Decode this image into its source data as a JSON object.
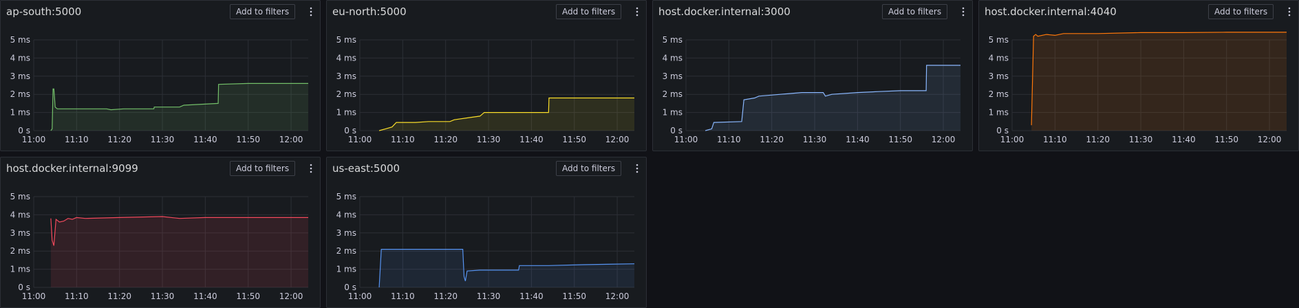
{
  "panels": [
    {
      "title": "ap-south:5000",
      "add_filters_label": "Add to filters",
      "menu_icon": "vertical-dots-icon",
      "color": "#73bf69",
      "fill": "rgba(115,191,105,0.12)",
      "chart_data": {
        "type": "line",
        "x_unit": "time",
        "y_unit": "ms",
        "y_ticks": [
          "0 s",
          "1 ms",
          "2 ms",
          "3 ms",
          "4 ms",
          "5 ms"
        ],
        "x_ticks": [
          "11:00",
          "11:10",
          "11:20",
          "11:30",
          "11:40",
          "11:50",
          "12:00"
        ],
        "ylim": [
          0,
          5
        ],
        "xlim_minutes": [
          0,
          64
        ],
        "series": [
          {
            "points": [
              [
                4.0,
                0
              ],
              [
                4.3,
                0.1
              ],
              [
                4.5,
                2.3
              ],
              [
                4.7,
                2.3
              ],
              [
                5.0,
                1.3
              ],
              [
                5.5,
                1.2
              ],
              [
                12,
                1.2
              ],
              [
                17,
                1.2
              ],
              [
                18,
                1.15
              ],
              [
                21,
                1.2
              ],
              [
                28,
                1.2
              ],
              [
                28.1,
                1.3
              ],
              [
                34,
                1.3
              ],
              [
                35,
                1.4
              ],
              [
                43,
                1.5
              ],
              [
                43.1,
                2.55
              ],
              [
                50,
                2.6
              ],
              [
                64,
                2.6
              ]
            ]
          }
        ]
      }
    },
    {
      "title": "eu-north:5000",
      "add_filters_label": "Add to filters",
      "menu_icon": "vertical-dots-icon",
      "color": "#fade2a",
      "fill": "rgba(250,222,42,0.10)",
      "chart_data": {
        "type": "line",
        "x_unit": "time",
        "y_unit": "ms",
        "y_ticks": [
          "0 s",
          "1 ms",
          "2 ms",
          "3 ms",
          "4 ms",
          "5 ms"
        ],
        "x_ticks": [
          "11:00",
          "11:10",
          "11:20",
          "11:30",
          "11:40",
          "11:50",
          "12:00"
        ],
        "ylim": [
          0,
          5
        ],
        "xlim_minutes": [
          0,
          64
        ],
        "series": [
          {
            "points": [
              [
                4.5,
                0
              ],
              [
                6,
                0.1
              ],
              [
                7.5,
                0.2
              ],
              [
                8.5,
                0.45
              ],
              [
                13,
                0.45
              ],
              [
                16,
                0.5
              ],
              [
                21,
                0.5
              ],
              [
                22,
                0.6
              ],
              [
                25,
                0.7
              ],
              [
                28,
                0.8
              ],
              [
                29,
                1.0
              ],
              [
                31,
                1.0
              ],
              [
                44,
                1.0
              ],
              [
                44.1,
                1.8
              ],
              [
                64,
                1.8
              ]
            ]
          }
        ]
      }
    },
    {
      "title": "host.docker.internal:3000",
      "add_filters_label": "Add to filters",
      "menu_icon": "vertical-dots-icon",
      "color": "#8ab8ff",
      "fill": "rgba(138,184,255,0.10)",
      "chart_data": {
        "type": "line",
        "x_unit": "time",
        "y_unit": "ms",
        "y_ticks": [
          "0 s",
          "1 ms",
          "2 ms",
          "3 ms",
          "4 ms",
          "5 ms"
        ],
        "x_ticks": [
          "11:00",
          "11:10",
          "11:20",
          "11:30",
          "11:40",
          "11:50",
          "12:00"
        ],
        "ylim": [
          0,
          5
        ],
        "xlim_minutes": [
          0,
          64
        ],
        "series": [
          {
            "points": [
              [
                4.5,
                0
              ],
              [
                6,
                0.1
              ],
              [
                6.5,
                0.45
              ],
              [
                13,
                0.5
              ],
              [
                13.5,
                1.7
              ],
              [
                16,
                1.8
              ],
              [
                17,
                1.9
              ],
              [
                22,
                2.0
              ],
              [
                27,
                2.1
              ],
              [
                32,
                2.1
              ],
              [
                32.5,
                1.9
              ],
              [
                34,
                2.0
              ],
              [
                40,
                2.1
              ],
              [
                45,
                2.15
              ],
              [
                50,
                2.2
              ],
              [
                56,
                2.2
              ],
              [
                56.1,
                3.6
              ],
              [
                64,
                3.6
              ]
            ]
          }
        ]
      }
    },
    {
      "title": "host.docker.internal:4040",
      "add_filters_label": "Add to filters",
      "menu_icon": "vertical-dots-icon",
      "color": "#ff780a",
      "fill": "rgba(255,120,10,0.12)",
      "chart_data": {
        "type": "line",
        "x_unit": "time",
        "y_unit": "ms",
        "y_ticks": [
          "0 s",
          "1 ms",
          "2 ms",
          "3 ms",
          "4 ms",
          "5 ms"
        ],
        "x_ticks": [
          "11:00",
          "11:10",
          "11:20",
          "11:30",
          "11:40",
          "11:50",
          "12:00"
        ],
        "ylim": [
          0,
          5
        ],
        "xlim_minutes": [
          0,
          64
        ],
        "series": [
          {
            "points": [
              [
                4.5,
                0.3
              ],
              [
                5.0,
                5.2
              ],
              [
                5.5,
                5.3
              ],
              [
                6,
                5.2
              ],
              [
                8,
                5.3
              ],
              [
                10,
                5.25
              ],
              [
                12,
                5.35
              ],
              [
                20,
                5.35
              ],
              [
                30,
                5.4
              ],
              [
                40,
                5.4
              ],
              [
                50,
                5.42
              ],
              [
                64,
                5.42
              ]
            ]
          }
        ]
      }
    },
    {
      "title": "host.docker.internal:9099",
      "add_filters_label": "Add to filters",
      "menu_icon": "vertical-dots-icon",
      "color": "#f2495c",
      "fill": "rgba(242,73,92,0.12)",
      "chart_data": {
        "type": "line",
        "x_unit": "time",
        "y_unit": "ms",
        "y_ticks": [
          "0 s",
          "1 ms",
          "2 ms",
          "3 ms",
          "4 ms",
          "5 ms"
        ],
        "x_ticks": [
          "11:00",
          "11:10",
          "11:20",
          "11:30",
          "11:40",
          "11:50",
          "12:00"
        ],
        "ylim": [
          0,
          5
        ],
        "xlim_minutes": [
          0,
          64
        ],
        "series": [
          {
            "points": [
              [
                4.0,
                3.8
              ],
              [
                4.3,
                2.6
              ],
              [
                4.7,
                2.3
              ],
              [
                5.2,
                3.75
              ],
              [
                6,
                3.6
              ],
              [
                7,
                3.65
              ],
              [
                8,
                3.8
              ],
              [
                9,
                3.75
              ],
              [
                10,
                3.85
              ],
              [
                12,
                3.8
              ],
              [
                20,
                3.85
              ],
              [
                30,
                3.9
              ],
              [
                34,
                3.8
              ],
              [
                40,
                3.85
              ],
              [
                50,
                3.85
              ],
              [
                64,
                3.85
              ]
            ]
          }
        ]
      }
    },
    {
      "title": "us-east:5000",
      "add_filters_label": "Add to filters",
      "menu_icon": "vertical-dots-icon",
      "color": "#5794f2",
      "fill": "rgba(87,148,242,0.10)",
      "chart_data": {
        "type": "line",
        "x_unit": "time",
        "y_unit": "ms",
        "y_ticks": [
          "0 s",
          "1 ms",
          "2 ms",
          "3 ms",
          "4 ms",
          "5 ms"
        ],
        "x_ticks": [
          "11:00",
          "11:10",
          "11:20",
          "11:30",
          "11:40",
          "11:50",
          "12:00"
        ],
        "ylim": [
          0,
          5
        ],
        "xlim_minutes": [
          0,
          64
        ],
        "series": [
          {
            "points": [
              [
                4.5,
                0
              ],
              [
                5,
                2.1
              ],
              [
                12,
                2.1
              ],
              [
                14,
                2.1
              ],
              [
                24,
                2.1
              ],
              [
                24.3,
                0.6
              ],
              [
                24.6,
                0.35
              ],
              [
                25,
                0.9
              ],
              [
                28,
                0.95
              ],
              [
                37,
                0.95
              ],
              [
                37.2,
                1.2
              ],
              [
                44,
                1.2
              ],
              [
                52,
                1.25
              ],
              [
                64,
                1.3
              ]
            ]
          }
        ]
      }
    }
  ]
}
